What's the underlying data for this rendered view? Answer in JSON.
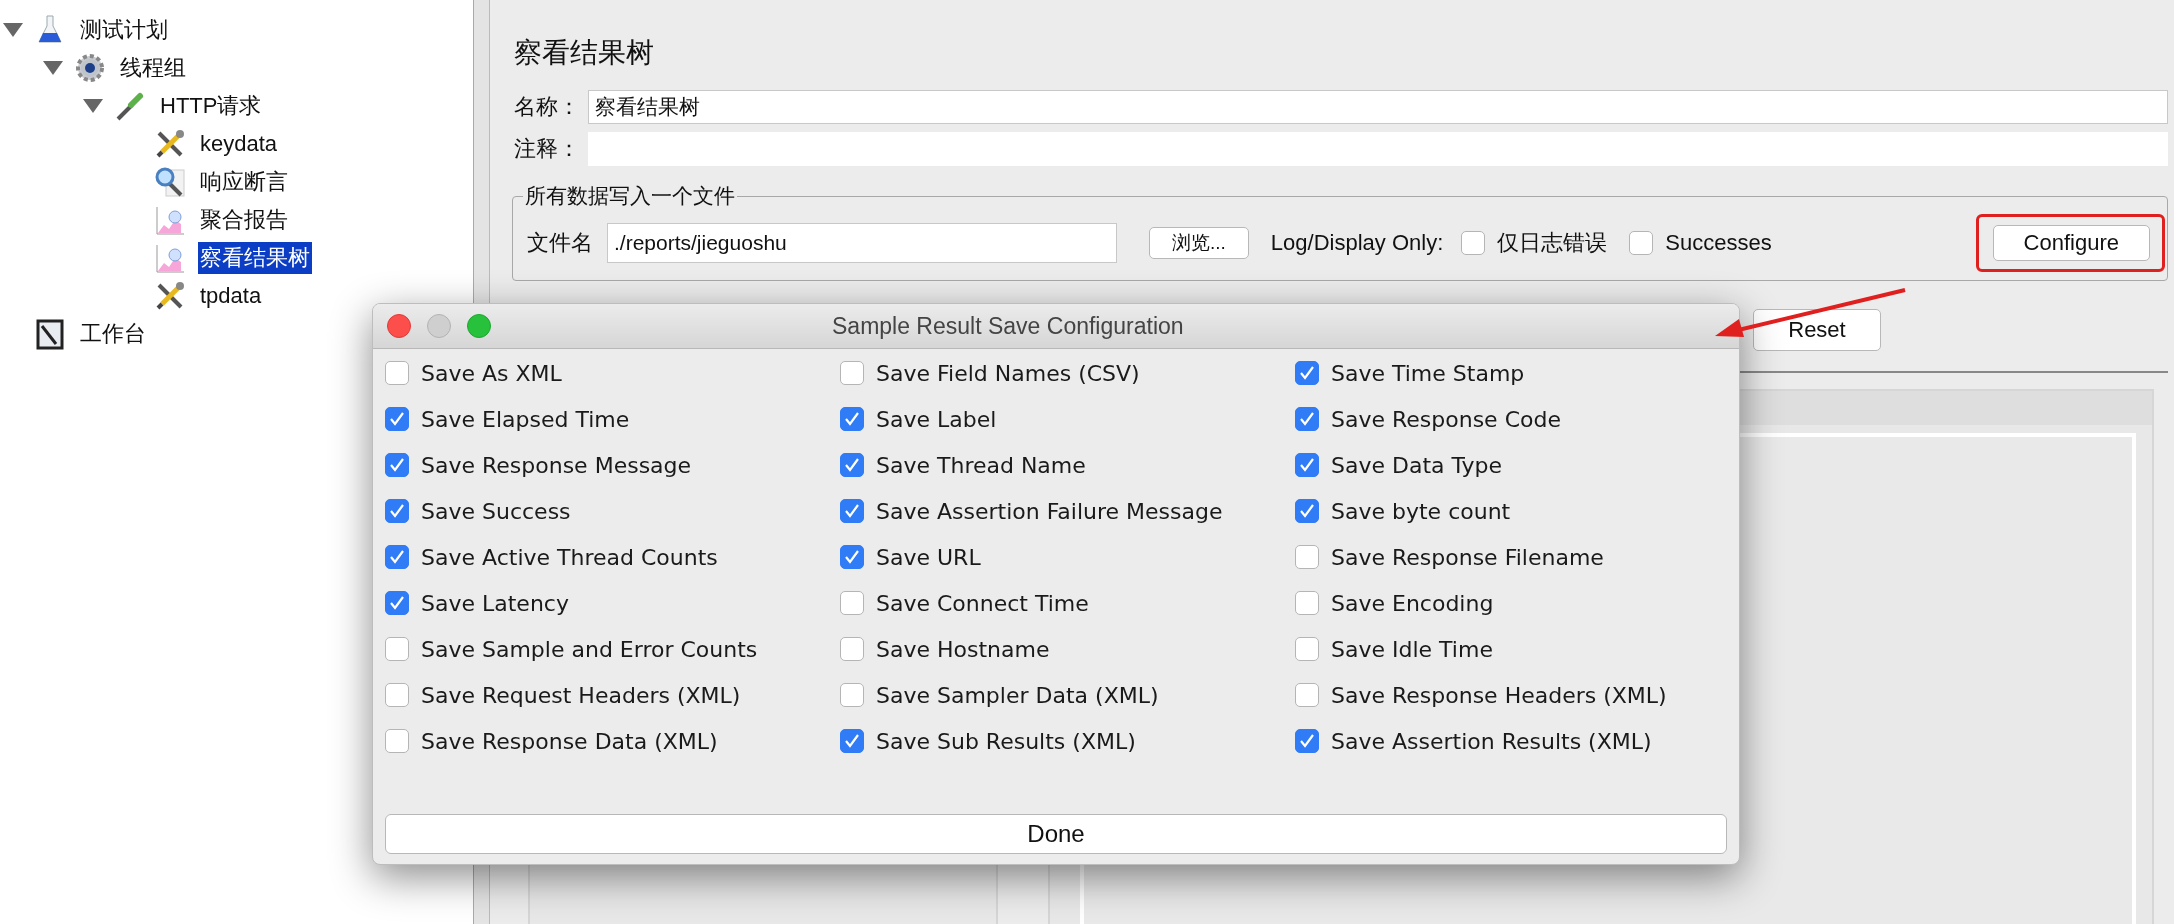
{
  "tree": [
    {
      "label": "测试计划",
      "kind": "plan",
      "expanded": true,
      "selected": false,
      "children": [
        {
          "label": "线程组",
          "kind": "thread-group",
          "expanded": true,
          "selected": false,
          "children": [
            {
              "label": "HTTP请求",
              "kind": "sampler",
              "expanded": true,
              "selected": false,
              "children": [
                {
                  "label": "keydata",
                  "kind": "config",
                  "selected": false
                },
                {
                  "label": "响应断言",
                  "kind": "assertion",
                  "selected": false
                },
                {
                  "label": "聚合报告",
                  "kind": "listener",
                  "selected": false
                },
                {
                  "label": "察看结果树",
                  "kind": "listener",
                  "selected": true
                },
                {
                  "label": "tpdata",
                  "kind": "config",
                  "selected": false
                }
              ]
            }
          ]
        }
      ]
    },
    {
      "label": "工作台",
      "kind": "workbench",
      "selected": false
    }
  ],
  "panel": {
    "title": "察看结果树",
    "name_label": "名称：",
    "name_value": "察看结果树",
    "comment_label": "注释：",
    "file_group": {
      "legend": "所有数据写入一个文件",
      "file_label": "文件名",
      "file_value": "./reports/jieguoshu",
      "browse_button": "浏览...",
      "log_label": "Log/Display Only:",
      "options": [
        {
          "label": "仅日志错误",
          "checked": false
        },
        {
          "label": "Successes",
          "checked": false
        }
      ],
      "configure_button": {
        "label": "Configure",
        "highlighted": true
      }
    },
    "reset_button": "Reset"
  },
  "dialog": {
    "title": "Sample Result Save Configuration",
    "options": [
      {
        "label": "Save As XML",
        "checked": false
      },
      {
        "label": "Save Field Names (CSV)",
        "checked": false
      },
      {
        "label": "Save Time Stamp",
        "checked": true
      },
      {
        "label": "Save Elapsed Time",
        "checked": true
      },
      {
        "label": "Save Label",
        "checked": true
      },
      {
        "label": "Save Response Code",
        "checked": true
      },
      {
        "label": "Save Response Message",
        "checked": true
      },
      {
        "label": "Save Thread Name",
        "checked": true
      },
      {
        "label": "Save Data Type",
        "checked": true
      },
      {
        "label": "Save Success",
        "checked": true
      },
      {
        "label": "Save Assertion Failure Message",
        "checked": true
      },
      {
        "label": "Save byte count",
        "checked": true
      },
      {
        "label": "Save Active Thread Counts",
        "checked": true
      },
      {
        "label": "Save URL",
        "checked": true
      },
      {
        "label": "Save Response Filename",
        "checked": false
      },
      {
        "label": "Save Latency",
        "checked": true
      },
      {
        "label": "Save Connect Time",
        "checked": false
      },
      {
        "label": "Save Encoding",
        "checked": false
      },
      {
        "label": "Save Sample and Error Counts",
        "checked": false
      },
      {
        "label": "Save Hostname",
        "checked": false
      },
      {
        "label": "Save Idle Time",
        "checked": false
      },
      {
        "label": "Save Request Headers (XML)",
        "checked": false
      },
      {
        "label": "Save Sampler Data (XML)",
        "checked": false
      },
      {
        "label": "Save Response Headers (XML)",
        "checked": false
      },
      {
        "label": "Save Response Data (XML)",
        "checked": false
      },
      {
        "label": "Save Sub Results (XML)",
        "checked": true
      },
      {
        "label": "Save Assertion Results (XML)",
        "checked": true
      }
    ],
    "done_button": "Done"
  }
}
